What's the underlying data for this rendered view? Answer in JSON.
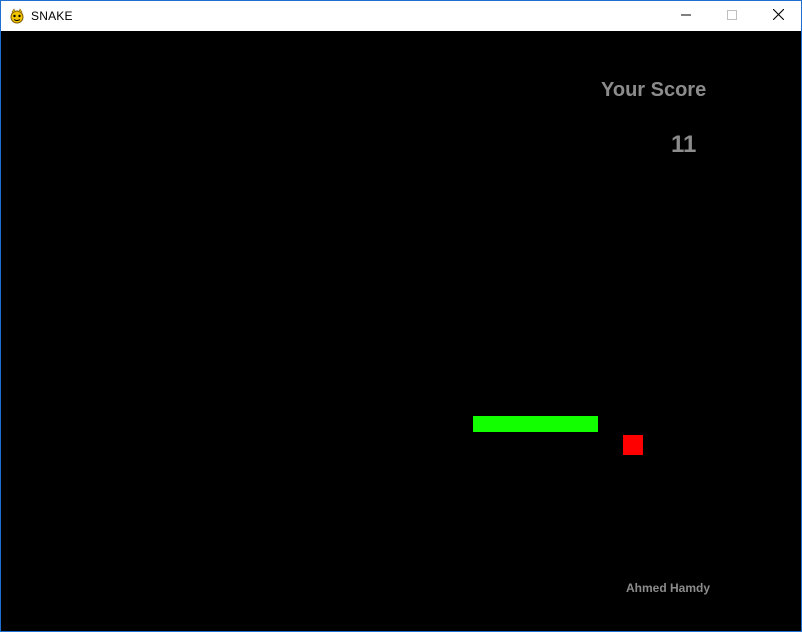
{
  "window": {
    "title": "SNAKE",
    "app_icon": "pygame-snake-icon",
    "controls": {
      "minimize_icon": "minimize-icon",
      "maximize_icon": "maximize-icon",
      "close_icon": "close-icon"
    }
  },
  "game": {
    "background_color": "#000000",
    "score_label": "Your Score",
    "score_value": "11",
    "author": "Ahmed Hamdy",
    "text_color": "#8c8c8c",
    "snake_color": "#12ff00",
    "food_color": "#ff0000"
  }
}
